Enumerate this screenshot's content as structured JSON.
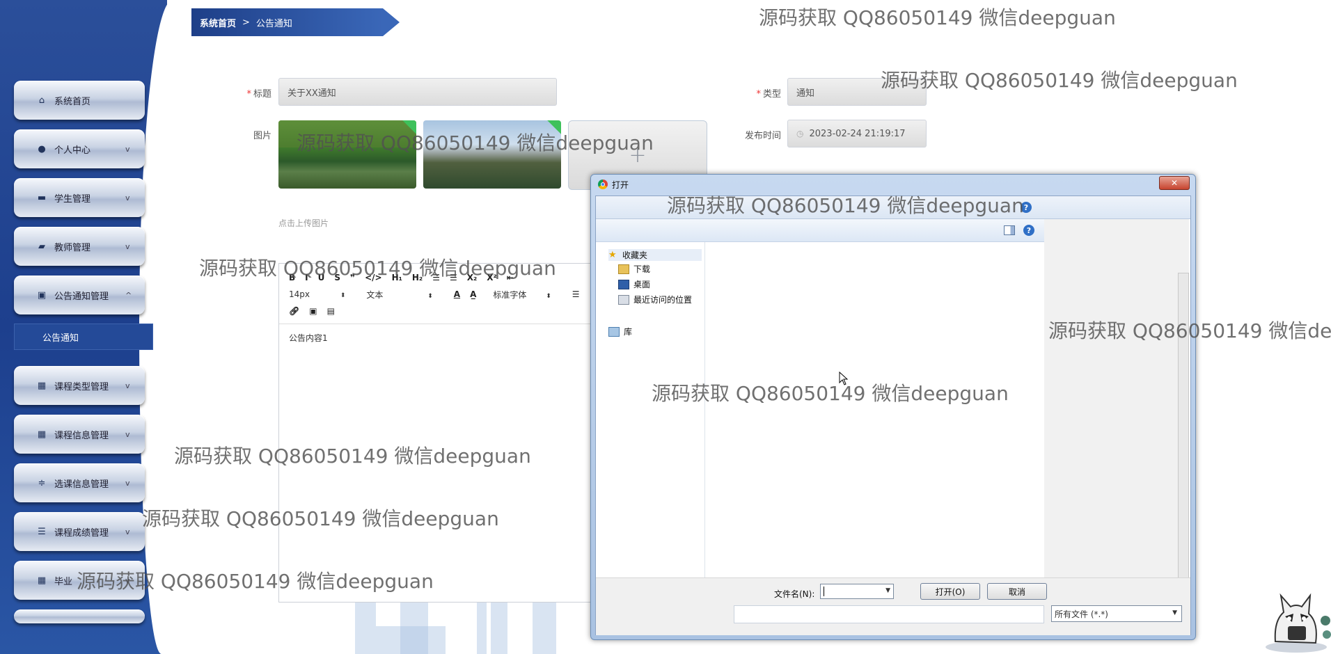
{
  "sidebar": {
    "items": [
      {
        "label": "系统首页",
        "icon": "home-icon",
        "has_chevron": false
      },
      {
        "label": "个人中心",
        "icon": "user-icon",
        "has_chevron": true
      },
      {
        "label": "学生管理",
        "icon": "briefcase-icon",
        "has_chevron": true
      },
      {
        "label": "教师管理",
        "icon": "wallet-icon",
        "has_chevron": true
      },
      {
        "label": "公告通知管理",
        "icon": "clipboard-icon",
        "has_chevron": true
      },
      {
        "label": "课程类型管理",
        "icon": "grid-icon",
        "has_chevron": true
      },
      {
        "label": "课程信息管理",
        "icon": "grid-icon",
        "has_chevron": true
      },
      {
        "label": "选课信息管理",
        "icon": "sliders-icon",
        "has_chevron": true
      },
      {
        "label": "课程成绩管理",
        "icon": "list-icon",
        "has_chevron": true
      },
      {
        "label": "毕业",
        "icon": "grid-icon",
        "has_chevron": true
      }
    ],
    "active_sub": "公告通知",
    "expanded_chevron": "^",
    "collapsed_chevron": "v"
  },
  "breadcrumb": {
    "home": "系统首页",
    "separator": ">",
    "current": "公告通知"
  },
  "form": {
    "title_label": "标题",
    "title_value": "关于XX通知",
    "type_label": "类型",
    "type_value": "通知",
    "image_label": "图片",
    "publish_label": "发布时间",
    "publish_value": "2023-02-24 21:19:17",
    "upload_hint": "点击上传图片",
    "upload_plus": "+"
  },
  "editor": {
    "toolbar_row1": [
      "B",
      "I",
      "U",
      "S",
      "❞",
      "</>",
      "H₁",
      "H₂",
      "☰",
      "☰",
      "X₂",
      "X²",
      "⇤"
    ],
    "font_size": "14px",
    "block_type": "文本",
    "font_family": "标准字体",
    "content": "公告内容1"
  },
  "dialog": {
    "title": "打开",
    "close_label": "✕",
    "nav": {
      "favorites": "收藏夹",
      "items": [
        "下载",
        "桌面",
        "最近访问的位置"
      ],
      "library": "库"
    },
    "filename_label": "文件名(N):",
    "filename_value": "",
    "open_label": "打开(O)",
    "cancel_label": "取消",
    "filetype_value": "所有文件 (*.*)"
  },
  "watermark_text": "源码获取 QQ86050149 微信deepguan",
  "colors": {
    "sidebar": "#1d3f8d",
    "breadcrumb": "#1e3f88",
    "required": "#e33333",
    "upload_tag": "#3ec15b"
  }
}
